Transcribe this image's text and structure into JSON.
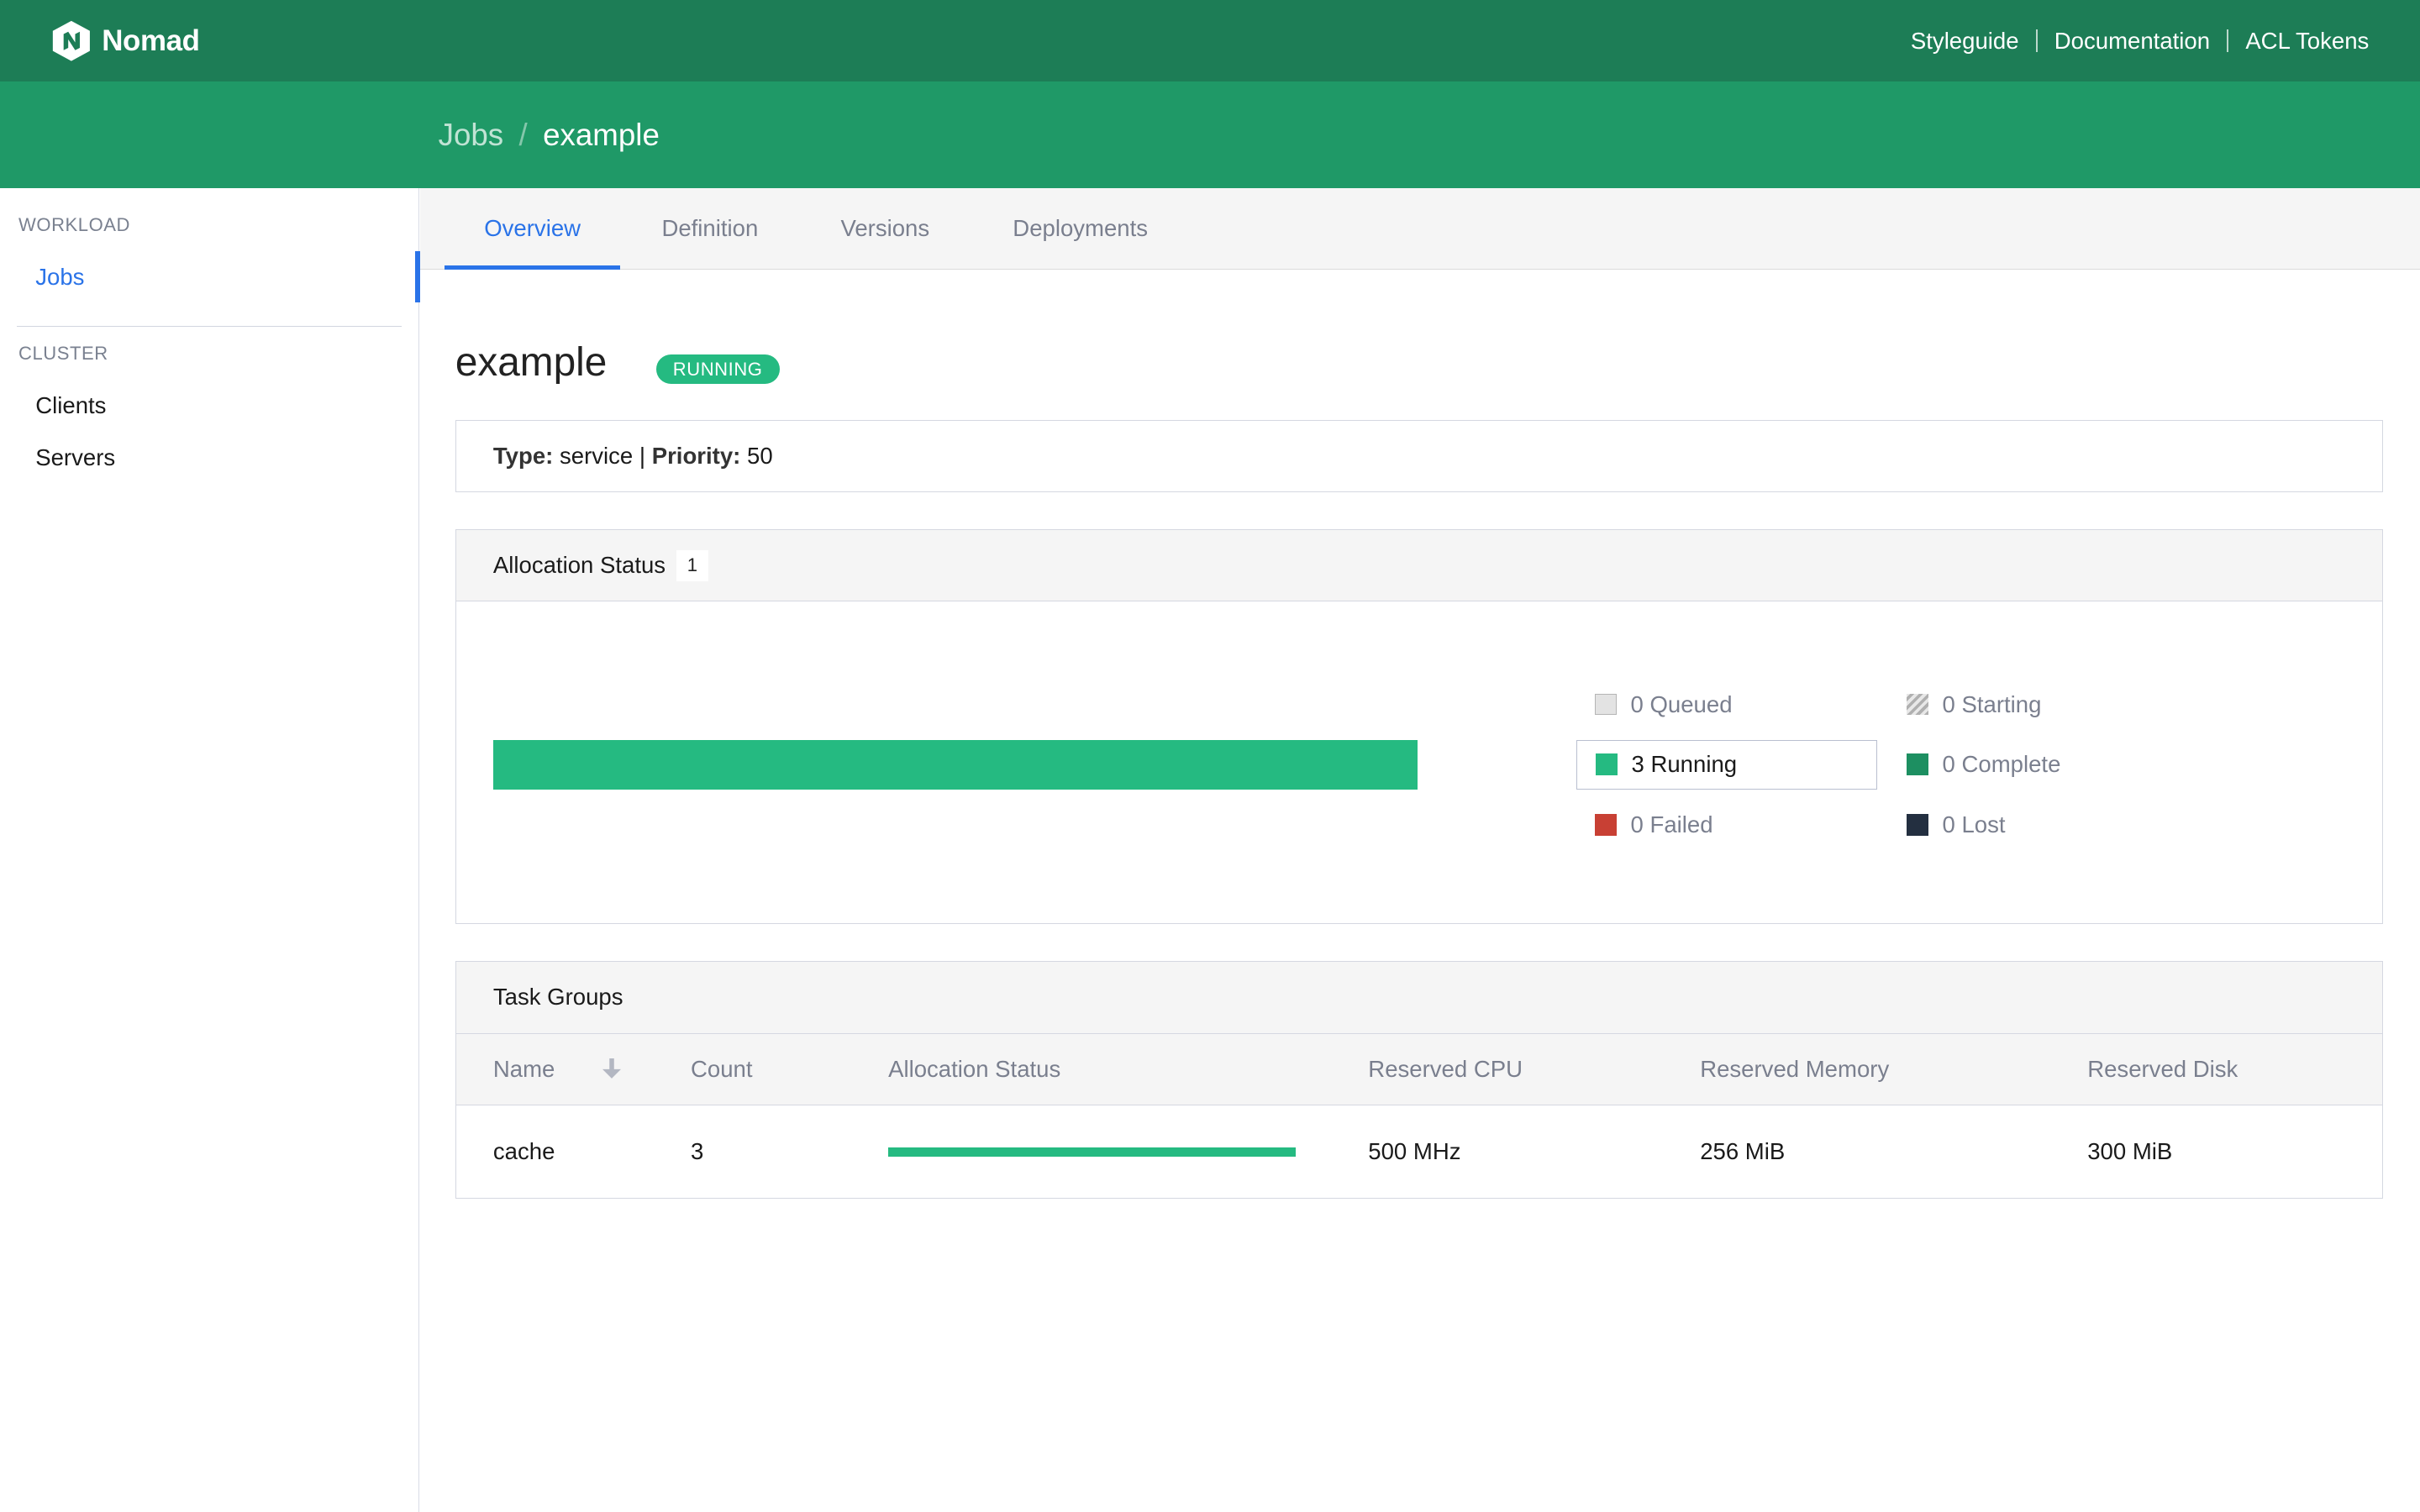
{
  "app": {
    "name": "Nomad",
    "nav_links": [
      {
        "label": "Styleguide"
      },
      {
        "label": "Documentation"
      },
      {
        "label": "ACL Tokens"
      }
    ]
  },
  "breadcrumbs": [
    {
      "label": "Jobs"
    },
    {
      "label": "example"
    }
  ],
  "sidebar": {
    "sections": [
      {
        "label": "WORKLOAD",
        "items": [
          {
            "label": "Jobs",
            "active": true
          }
        ]
      },
      {
        "label": "CLUSTER",
        "items": [
          {
            "label": "Clients"
          },
          {
            "label": "Servers"
          }
        ]
      }
    ]
  },
  "tabs": [
    {
      "label": "Overview",
      "active": true
    },
    {
      "label": "Definition"
    },
    {
      "label": "Versions"
    },
    {
      "label": "Deployments"
    }
  ],
  "job": {
    "name": "example",
    "status": "RUNNING",
    "type_label": "Type:",
    "type": "service",
    "separator": "|",
    "priority_label": "Priority:",
    "priority": "50"
  },
  "allocation_status": {
    "title": "Allocation Status",
    "count": "1",
    "running_fraction": 1.0,
    "legend": [
      {
        "label": "0 Queued",
        "color": "#e3e3e3"
      },
      {
        "label": "0 Starting",
        "color": "#b0b0b0"
      },
      {
        "label": "3 Running",
        "color": "#25ba81",
        "selected": true
      },
      {
        "label": "0 Complete",
        "color": "#1d8f61"
      },
      {
        "label": "0 Failed",
        "color": "#c84034"
      },
      {
        "label": "0 Lost",
        "color": "#232f40"
      }
    ]
  },
  "task_groups": {
    "title": "Task Groups",
    "columns": [
      "Name",
      "Count",
      "Allocation Status",
      "Reserved CPU",
      "Reserved Memory",
      "Reserved Disk"
    ],
    "sort_icon": "sort-desc-icon",
    "rows": [
      {
        "name": "cache",
        "count": "3",
        "running_fraction": 1.0,
        "cpu": "500 MHz",
        "memory": "256 MiB",
        "disk": "300 MiB"
      }
    ]
  },
  "colors": {
    "nav": "#1d7d56",
    "subnav": "#1f9967",
    "accent": "#2a73e8",
    "running": "#25ba81"
  }
}
